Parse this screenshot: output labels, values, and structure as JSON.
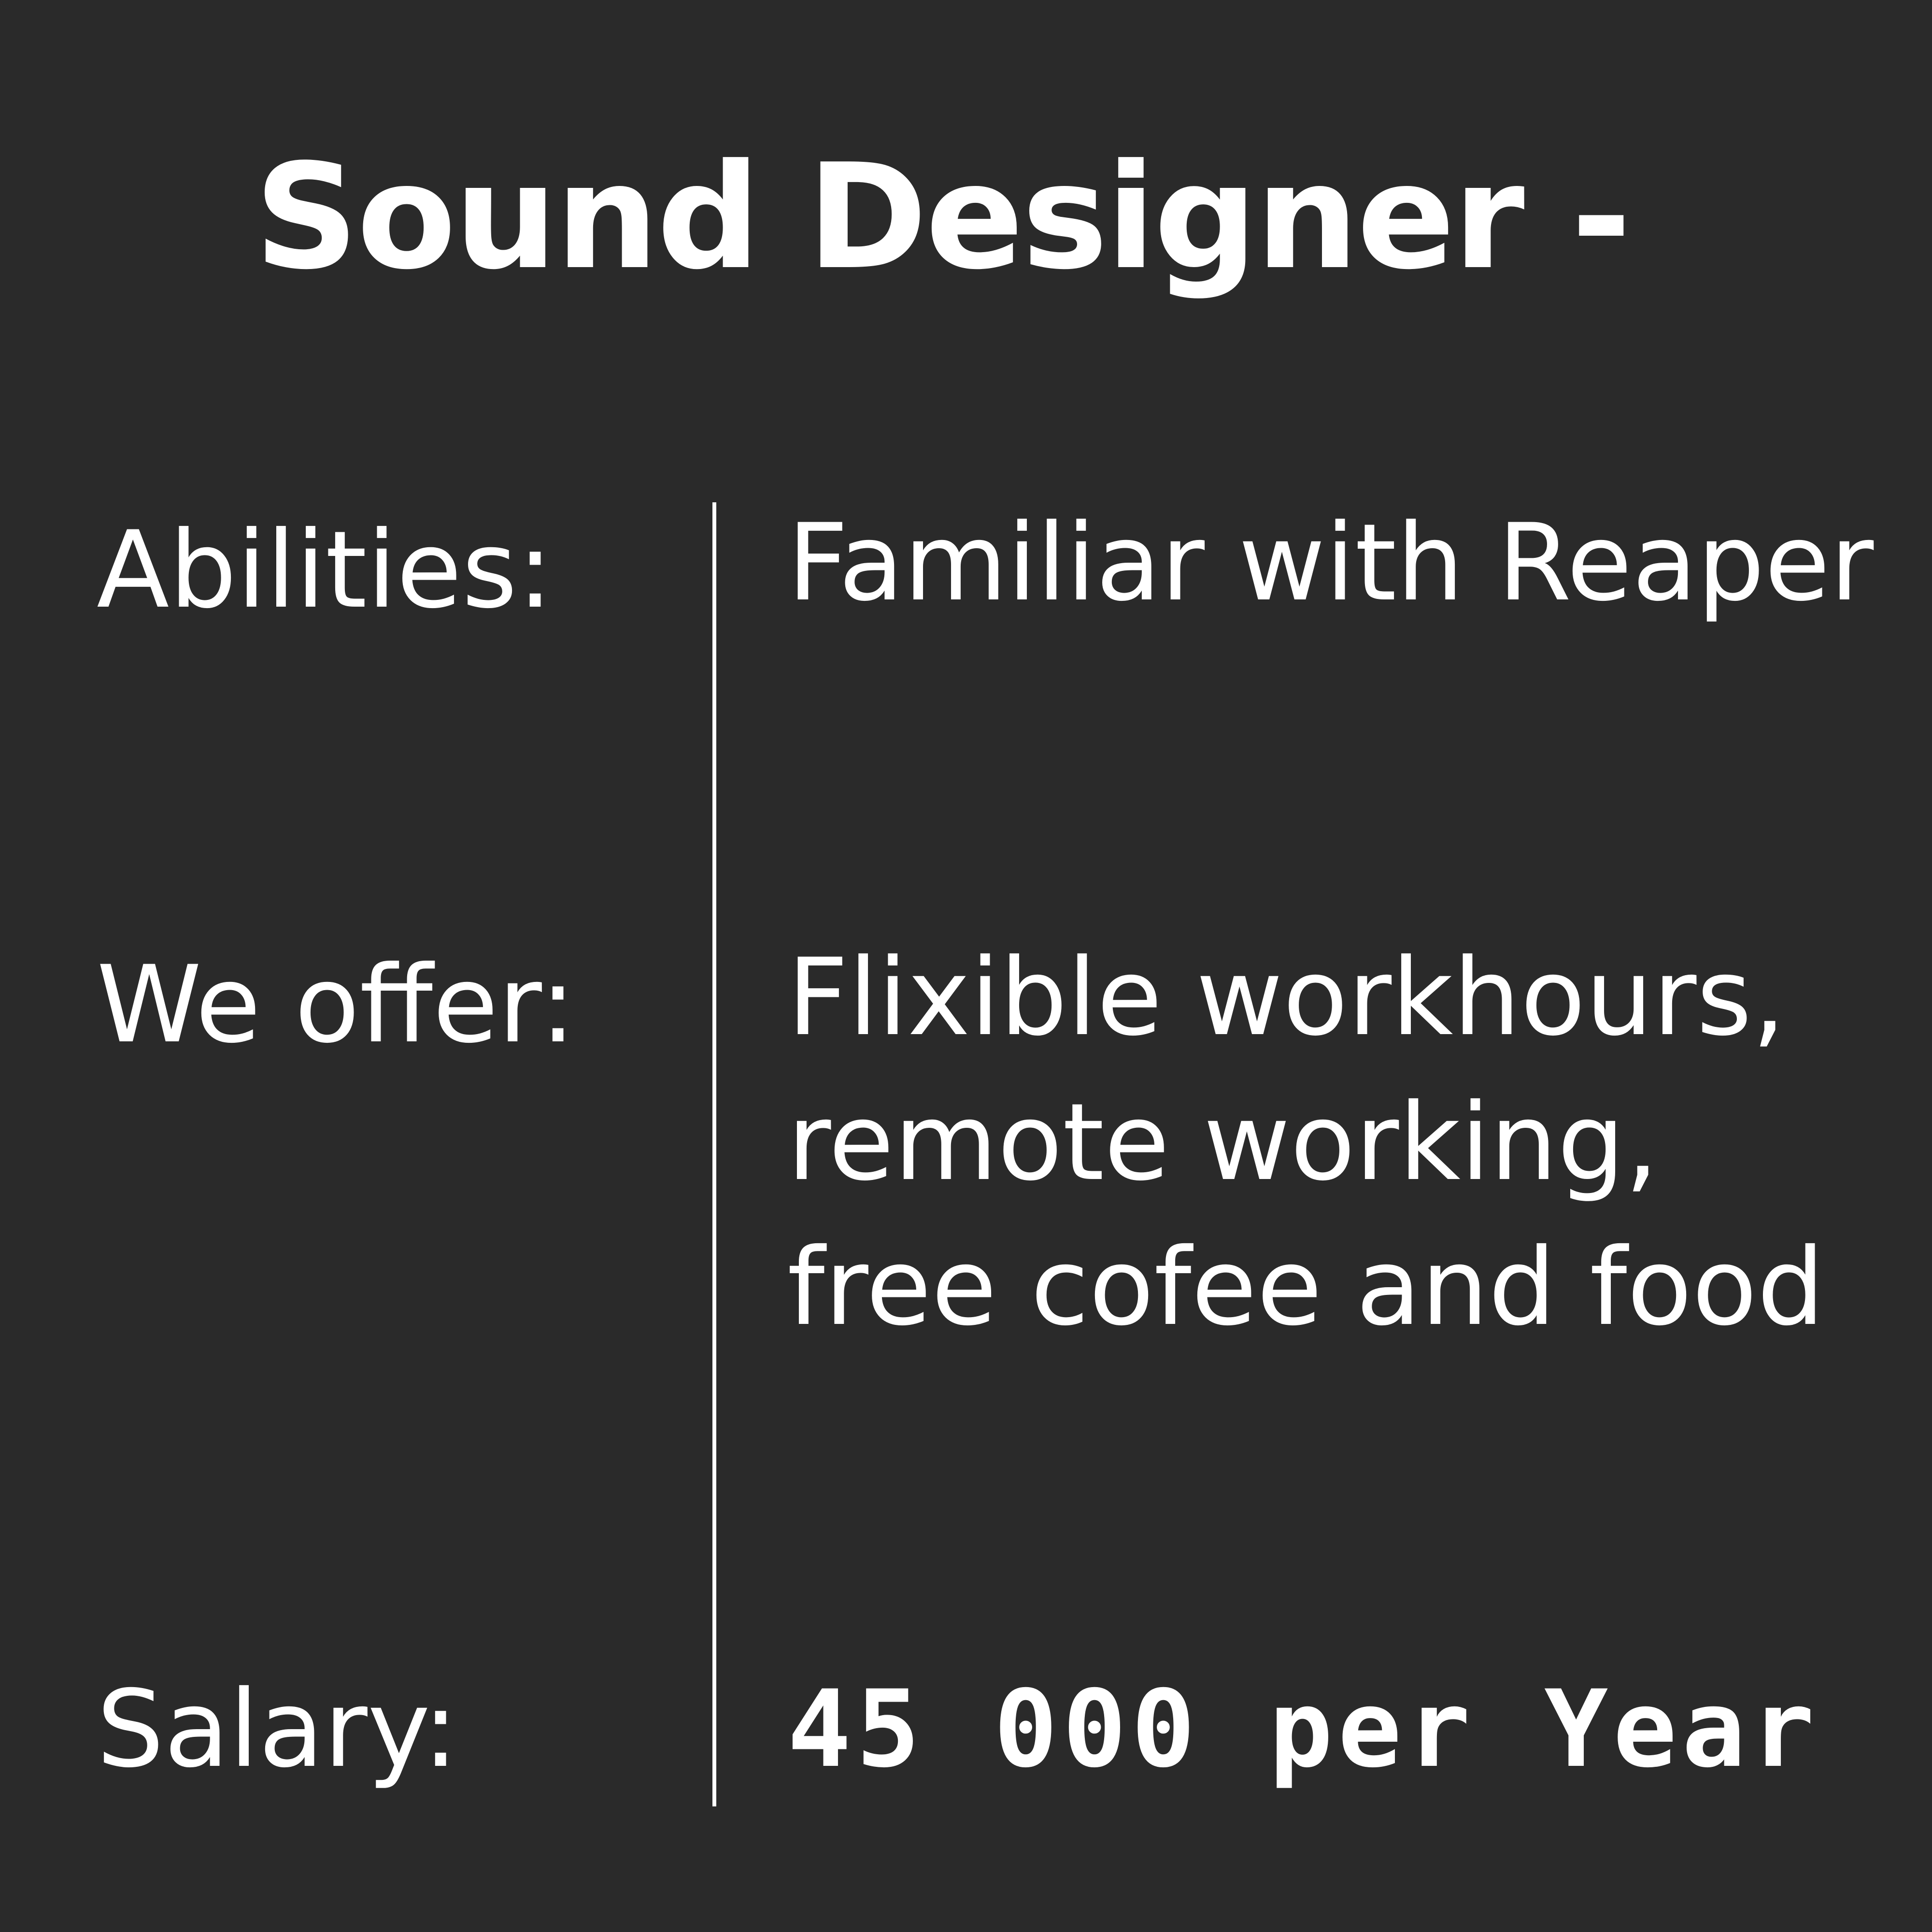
{
  "title": "Sound Designer -",
  "abilities": {
    "label": "Abilities:",
    "value": "Familiar with Reaper"
  },
  "offer": {
    "label": "We offer:",
    "value": "Flixible workhours, remote working, free cofee and food"
  },
  "salary": {
    "label": "Salary:",
    "value": "45 000 per Year"
  },
  "colors": {
    "background": "#2a2a2a",
    "text": "#ffffff",
    "divider": "#ffffff"
  }
}
